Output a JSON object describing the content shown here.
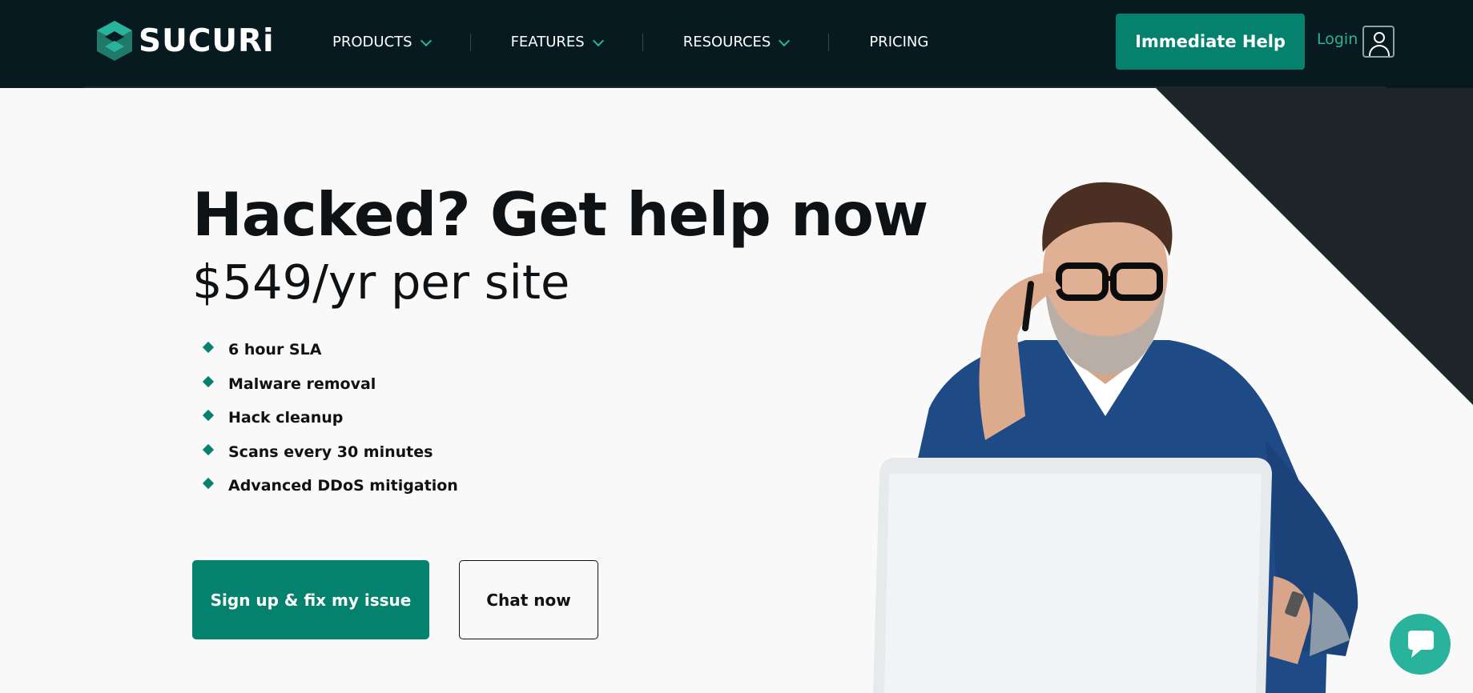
{
  "brand": {
    "name": "SUCURi"
  },
  "nav": {
    "items": [
      {
        "label": "PRODUCTS",
        "has_dropdown": true
      },
      {
        "label": "FEATURES",
        "has_dropdown": true
      },
      {
        "label": "RESOURCES",
        "has_dropdown": true
      },
      {
        "label": "PRICING",
        "has_dropdown": false
      }
    ]
  },
  "header": {
    "help_button": "Immediate Help",
    "login_label": "Login",
    "login_icon": "user-icon"
  },
  "hero": {
    "title": "Hacked? Get help now",
    "price": "$549/yr per site",
    "features": [
      "6 hour SLA",
      "Malware removal",
      "Hack cleanup",
      "Scans every 30 minutes",
      "Advanced DDoS mitigation"
    ],
    "primary_cta": "Sign up & fix my issue",
    "secondary_cta": "Chat now"
  },
  "chat_widget": {
    "icon": "chat-bubble-icon"
  },
  "colors": {
    "header_bg": "#061a1f",
    "accent": "#05826e",
    "accent_light": "#2ab39c",
    "page_bg": "#f9f9f9",
    "dark_shape": "#1f262a"
  }
}
